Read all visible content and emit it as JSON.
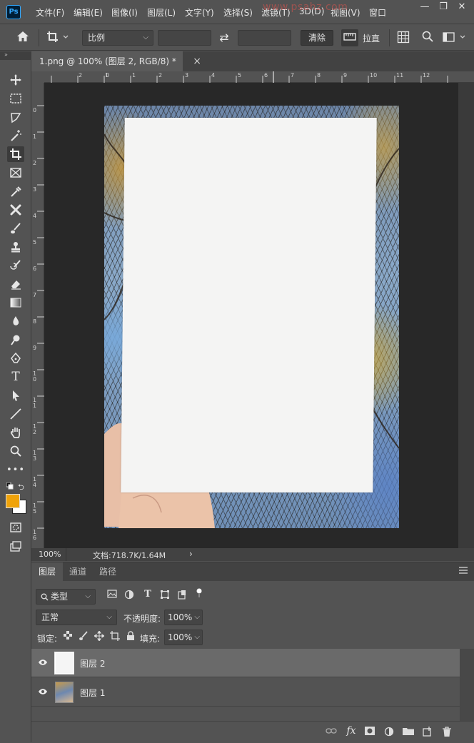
{
  "app": {
    "logo": "Ps"
  },
  "menu": [
    "文件(F)",
    "编辑(E)",
    "图像(I)",
    "图层(L)",
    "文字(Y)",
    "选择(S)",
    "滤镜(T)",
    "3D(D)",
    "视图(V)",
    "窗口"
  ],
  "watermark": "www.psahz.com",
  "window_controls": {
    "minimize": "—",
    "restore": "❐",
    "close": "✕"
  },
  "options": {
    "ratio_select": "比例",
    "width_value": "",
    "height_value": "",
    "swap_symbol": "⇄",
    "clear_button": "清除",
    "straighten_label": "拉直"
  },
  "document_tab": {
    "title": "1.png @ 100% (图层 2, RGB/8) *",
    "close": "×"
  },
  "rulers": {
    "horizontal": [
      "2",
      "1",
      "0",
      "1",
      "2",
      "3",
      "4",
      "5",
      "6",
      "7",
      "8",
      "9",
      "10",
      "11",
      "12"
    ],
    "vertical": [
      "0",
      "1",
      "2",
      "3",
      "4",
      "5",
      "6",
      "7",
      "8",
      "9",
      "1\n0",
      "1\n1",
      "1\n2",
      "1\n3",
      "1\n4",
      "1\n5",
      "1\n6"
    ]
  },
  "status": {
    "zoom": "100%",
    "doc_info": "文档:718.7K/1.64M",
    "arrow": "›"
  },
  "layers_panel": {
    "tabs": [
      "图层",
      "通道",
      "路径"
    ],
    "active_tab": "图层",
    "filter_label": "类型",
    "blend_mode": "正常",
    "opacity_label": "不透明度:",
    "opacity_value": "100%",
    "lock_label": "锁定:",
    "fill_label": "填充:",
    "fill_value": "100%",
    "layers": [
      {
        "name": "图层 2",
        "selected": true
      },
      {
        "name": "图层 1",
        "selected": false
      }
    ],
    "bottom_icons": [
      "link-icon",
      "fx-icon",
      "mask-icon",
      "adjustment-icon",
      "folder-icon",
      "new-layer-icon",
      "trash-icon"
    ],
    "fx_text": "fx"
  },
  "colors": {
    "foreground": "#f0a30a",
    "background": "#ffffff",
    "panel_bg": "#535353",
    "canvas_bg": "#282828",
    "accent_blue": "#31a8ff"
  }
}
